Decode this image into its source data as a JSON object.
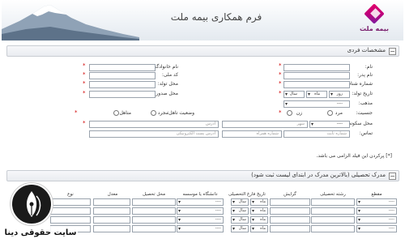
{
  "header": {
    "title": "فرم همکاری بیمه ملت",
    "logo_text": "بیمه ملت"
  },
  "personal_section": {
    "title": "مشخصات فردی",
    "collapse_symbol": "−",
    "right_fields": {
      "name": "نام:",
      "father_name": "نام پدر:",
      "id_number": "شماره شناسنامه:",
      "birth_date": "تاریخ تولد:",
      "religion": "مذهب:",
      "gender": "جنسیت:",
      "residence": "محل سکونت:",
      "contact": "تماس:"
    },
    "left_fields": {
      "last_name": "نام خانوادگی:",
      "national_code": "کد ملی:",
      "birth_place": "محل تولد:",
      "issue_place": "محل صدور:",
      "marital_status": "وضعیت تاهل:"
    },
    "required_mark": "*",
    "birth_date_selects": {
      "day": "روز",
      "month": "ماه",
      "year": "سال"
    },
    "religion_select": "----",
    "gender_options": {
      "male": "مرد",
      "female": "زن"
    },
    "marital_options": {
      "single": "مجرد",
      "married": "متاهل"
    },
    "residence_select": "----",
    "placeholders": {
      "city": "شهر",
      "address": "آدرس",
      "phone": "شماره ثابت",
      "mobile": "شماره همراه",
      "email": "آدرس پست الکترونیکی"
    },
    "required_note": "[*] پرکردن این فیلد الزامی می باشد."
  },
  "education_section": {
    "title": "مدرک تحصیلی (بالاترین مدرک در ابتدای لیست ثبت شود)",
    "collapse_symbol": "−",
    "columns": [
      "مقطع",
      "رشته تحصیلی",
      "گرایش",
      "تاریخ فارغ التحصیلی",
      "دانشگاه یا موسسه",
      "محل تحصیل",
      "معدل",
      "نوع"
    ],
    "select_placeholder": "----",
    "month_label": "ماه",
    "year_label": "سال",
    "row_count": 4
  },
  "watermark": {
    "text": "سایت حقوقی دینا"
  },
  "colors": {
    "required": "#d00000",
    "border": "#9aa3ad",
    "section_bg": "#e9ecf0",
    "logo_magenta": "#e3006b",
    "logo_purple": "#7a1fa2"
  }
}
